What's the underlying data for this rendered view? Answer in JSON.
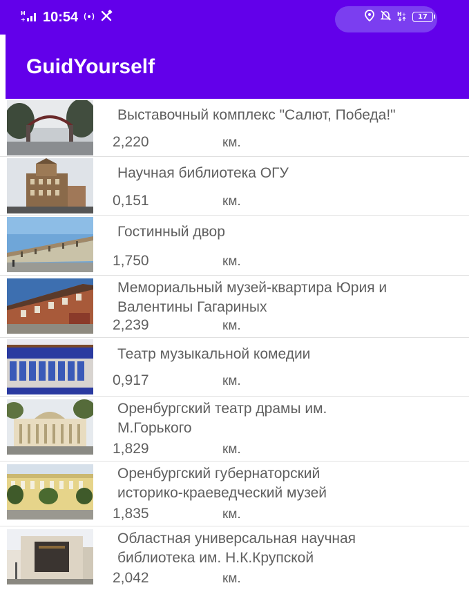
{
  "status_bar": {
    "signal_glyph": "H̑ıı",
    "time": "10:54",
    "indicator_left": "(·)",
    "tools_glyph": "⚒",
    "location_icon": "location-pin-icon",
    "silent_icon": "bell-off-icon",
    "network_glyph": "H⁺",
    "battery_level": "17"
  },
  "app_bar": {
    "title": "GuidYourself"
  },
  "places": [
    {
      "name": "Выставочный комплекс \"Салют, Победа!\"",
      "distance": "2,220",
      "unit": "км."
    },
    {
      "name": "Научная библиотека ОГУ",
      "distance": "0,151",
      "unit": "км."
    },
    {
      "name": "Гостинный двор",
      "distance": "1,750",
      "unit": "км."
    },
    {
      "name": "Мемориальный музей-квартира Юрия и",
      "name_line2": "Валентины Гагариных",
      "distance": "2,239",
      "unit": "км."
    },
    {
      "name": "Театр музыкальной комедии",
      "distance": "0,917",
      "unit": "км."
    },
    {
      "name": "Оренбургский театр драмы им.",
      "name_line2": "М.Горького",
      "distance": "1,829",
      "unit": "км."
    },
    {
      "name": "Оренбургский губернаторский",
      "name_line2": "историко-краеведческий музей",
      "distance": "1,835",
      "unit": "км."
    },
    {
      "name": "Областная универсальная научная",
      "name_line2": "библиотека им. Н.К.Крупской",
      "distance": "2,042",
      "unit": "км."
    }
  ],
  "colors": {
    "primary": "#6200ea",
    "text": "#5f5f5f",
    "divider": "#e0e0e0"
  }
}
